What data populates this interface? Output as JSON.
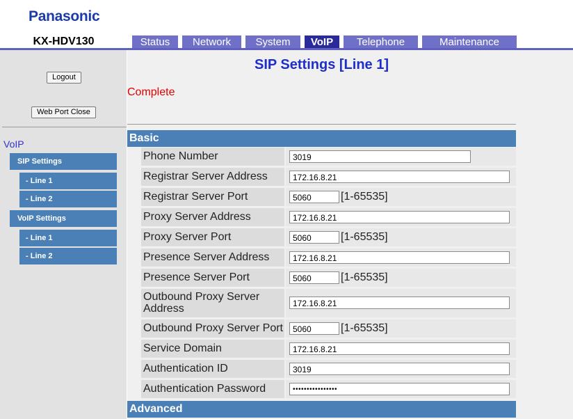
{
  "brand": "Panasonic",
  "model": "KX-HDV130",
  "tabs": [
    {
      "label": "Status"
    },
    {
      "label": "Network"
    },
    {
      "label": "System"
    },
    {
      "label": "VoIP"
    },
    {
      "label": "Telephone"
    },
    {
      "label": "Maintenance"
    }
  ],
  "sidebar": {
    "logout": "Logout",
    "web_port_close": "Web Port Close",
    "voip_label": "VoIP",
    "sip_settings": "SIP Settings",
    "sip_line1": "- Line 1",
    "sip_line2": "- Line 2",
    "voip_settings": "VoIP Settings",
    "voip_line1": "- Line 1",
    "voip_line2": "- Line 2"
  },
  "page": {
    "title": "SIP Settings [Line 1]",
    "status": "Complete"
  },
  "sections": {
    "basic": "Basic",
    "advanced": "Advanced"
  },
  "fields": {
    "phone_number": {
      "label": "Phone Number",
      "value": "3019"
    },
    "registrar_server_address": {
      "label": "Registrar Server Address",
      "value": "172.16.8.21"
    },
    "registrar_server_port": {
      "label": "Registrar Server Port",
      "value": "5060",
      "range": "[1-65535]"
    },
    "proxy_server_address": {
      "label": "Proxy Server Address",
      "value": "172.16.8.21"
    },
    "proxy_server_port": {
      "label": "Proxy Server Port",
      "value": "5060",
      "range": "[1-65535]"
    },
    "presence_server_address": {
      "label": "Presence Server Address",
      "value": "172.16.8.21"
    },
    "presence_server_port": {
      "label": "Presence Server Port",
      "value": "5060",
      "range": "[1-65535]"
    },
    "outbound_proxy_server_address": {
      "label_line1": "Outbound Proxy Server",
      "label_line2": "Address",
      "value": "172.16.8.21"
    },
    "outbound_proxy_server_port": {
      "label": "Outbound Proxy Server Port",
      "value": "5060",
      "range": "[1-65535]"
    },
    "service_domain": {
      "label": "Service Domain",
      "value": "172.16.8.21"
    },
    "authentication_id": {
      "label": "Authentication ID",
      "value": "3019"
    },
    "authentication_password": {
      "label": "Authentication Password",
      "value": "••••••••••••••••"
    }
  }
}
